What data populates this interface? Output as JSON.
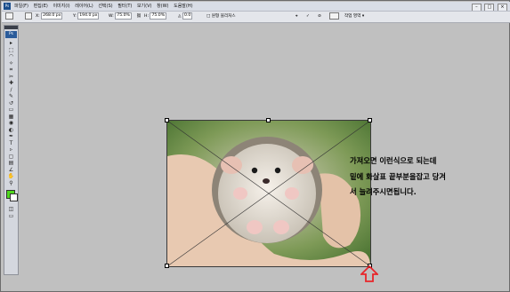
{
  "app": {
    "logo": "Ps"
  },
  "menu": {
    "items": [
      "파일(F)",
      "편집(E)",
      "이미지(I)",
      "레이어(L)",
      "선택(S)",
      "필터(T)",
      "보기(V)",
      "창(W)",
      "도움말(H)"
    ]
  },
  "window_controls": {
    "minimize": "–",
    "maximize": "□",
    "close": "×"
  },
  "options": {
    "x_label": "X:",
    "x_value": "268.0 px",
    "y_label": "Y:",
    "y_value": "194.0 px",
    "w_label": "W:",
    "w_value": "75.0%",
    "h_label": "H:",
    "h_value": "75.0%",
    "angle_value": "0.0",
    "interp_label": "□ 원형 블리처스",
    "workspace_label": "작업 영역 ▾"
  },
  "toolbox": {
    "title": "Ps",
    "icons": [
      "move-tool-icon",
      "marquee-tool-icon",
      "lasso-tool-icon",
      "magic-wand-icon",
      "crop-tool-icon",
      "slice-tool-icon",
      "healing-brush-icon",
      "brush-tool-icon",
      "clone-stamp-icon",
      "history-brush-icon",
      "eraser-icon",
      "gradient-icon",
      "blur-icon",
      "dodge-icon",
      "pen-tool-icon",
      "type-tool-icon",
      "path-select-icon",
      "shape-tool-icon",
      "notes-icon",
      "eyedropper-icon",
      "hand-tool-icon",
      "zoom-tool-icon"
    ],
    "glyphs": [
      "▸",
      "⬚",
      "◠",
      "✧",
      "⌗",
      "✂",
      "✚",
      "∕",
      "✎",
      "↺",
      "▭",
      "▦",
      "◉",
      "◐",
      "✒",
      "T",
      "▹",
      "▢",
      "▤",
      "∠",
      "✋",
      "⚲"
    ],
    "foreground_color": "#4fd81e",
    "background_color": "#ffffff"
  },
  "annotation": {
    "line1": "가져오면 이런식으로 되는데",
    "line2": "밑에 화살표 끝부분을잡고 당겨",
    "line3": "서 늘려주시면됩니다."
  },
  "colors": {
    "arrow": "#e8252a",
    "canvas_bg": "#c0c0c0"
  }
}
